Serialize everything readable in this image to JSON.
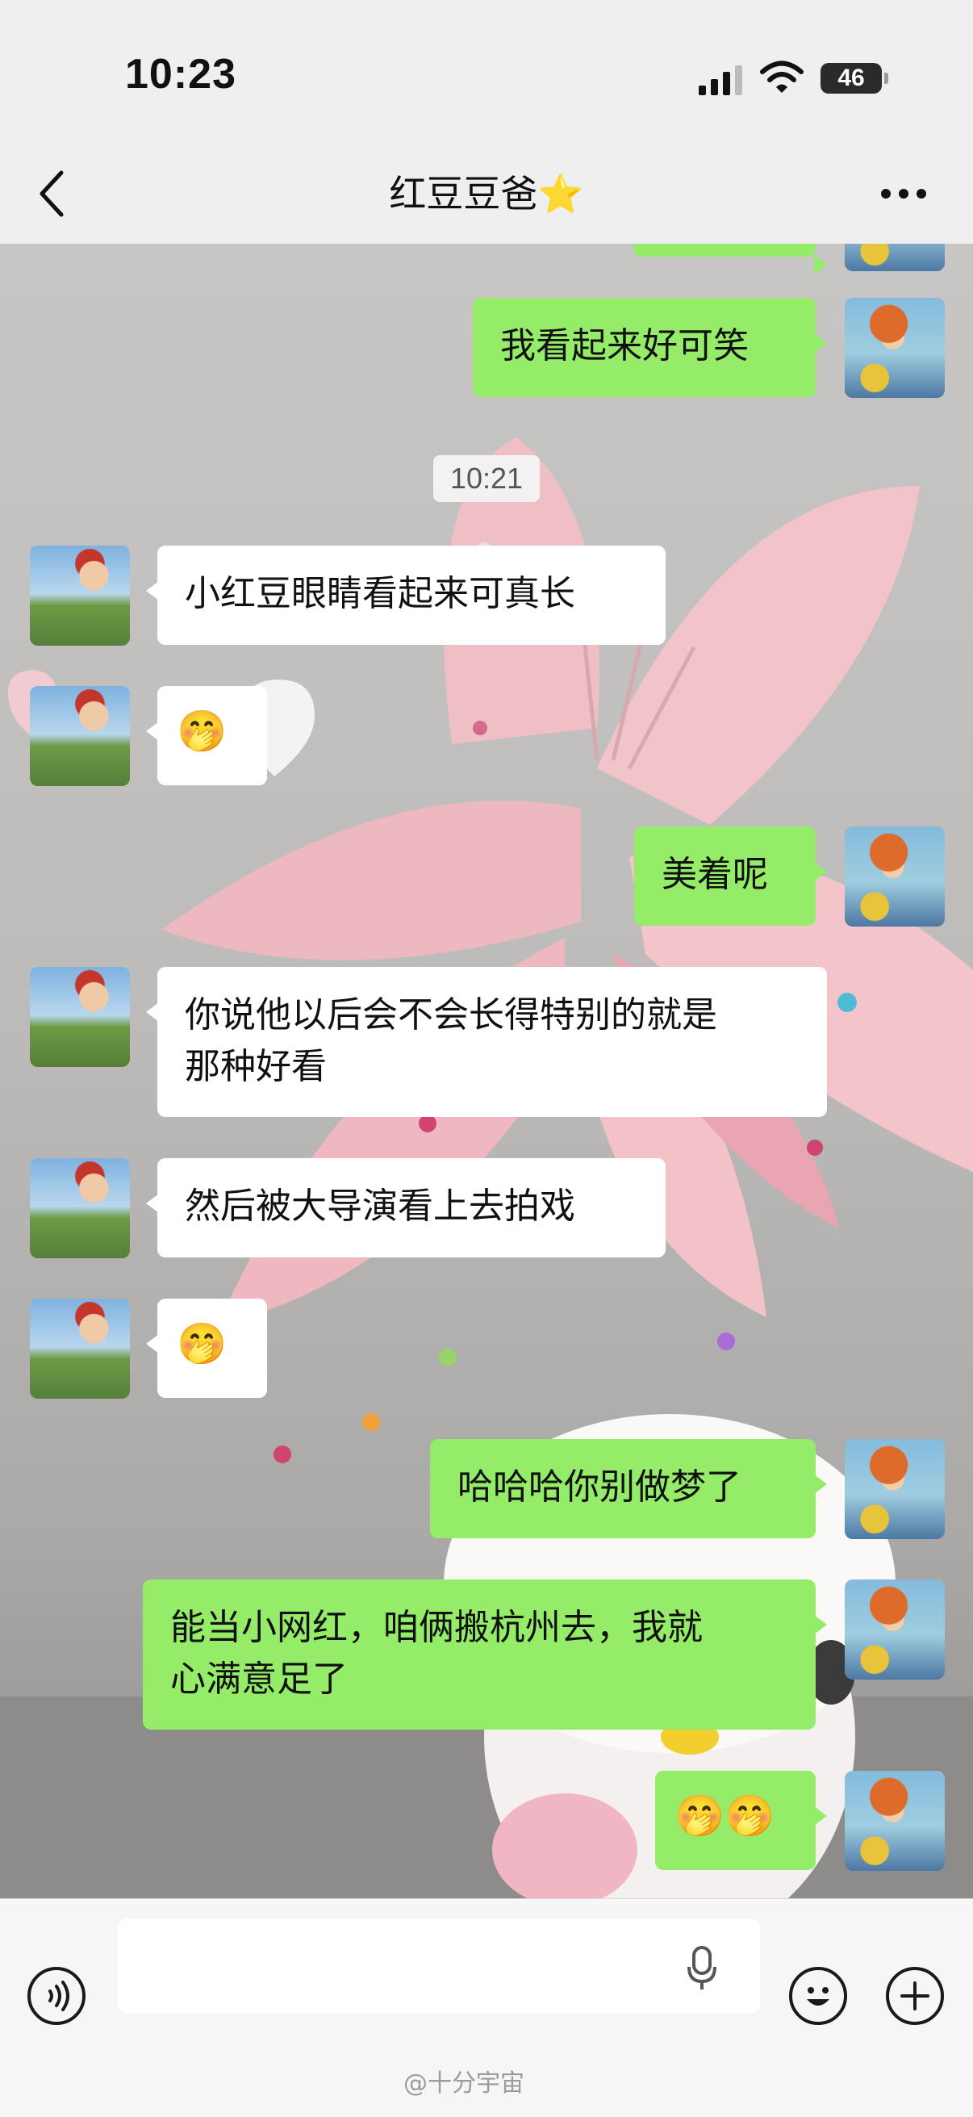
{
  "status_bar": {
    "time": "10:23",
    "battery": "46"
  },
  "nav": {
    "title": "红豆豆爸⭐"
  },
  "chat": {
    "timestamp": "10:21",
    "messages": [
      {
        "side": "out",
        "text": "我看起来好可笑"
      },
      {
        "side": "in",
        "text": "小红豆眼睛看起来可真长"
      },
      {
        "side": "in",
        "text": "🤭"
      },
      {
        "side": "out",
        "text": "美着呢"
      },
      {
        "side": "in",
        "text": "你说他以后会不会长得特别的就是\n那种好看"
      },
      {
        "side": "in",
        "text": "然后被大导演看上去拍戏"
      },
      {
        "side": "in",
        "text": "🤭"
      },
      {
        "side": "out",
        "text": "哈哈哈你别做梦了"
      },
      {
        "side": "out",
        "text": "能当小网红，咱俩搬杭州去，我就\n心满意足了"
      },
      {
        "side": "out",
        "text": "🤭🤭"
      }
    ]
  },
  "input_bar": {
    "placeholder": ""
  },
  "watermark": "@十分宇宙",
  "colors": {
    "outgoing_bubble": "#95ec69",
    "incoming_bubble": "#ffffff",
    "background": "#ededed"
  }
}
